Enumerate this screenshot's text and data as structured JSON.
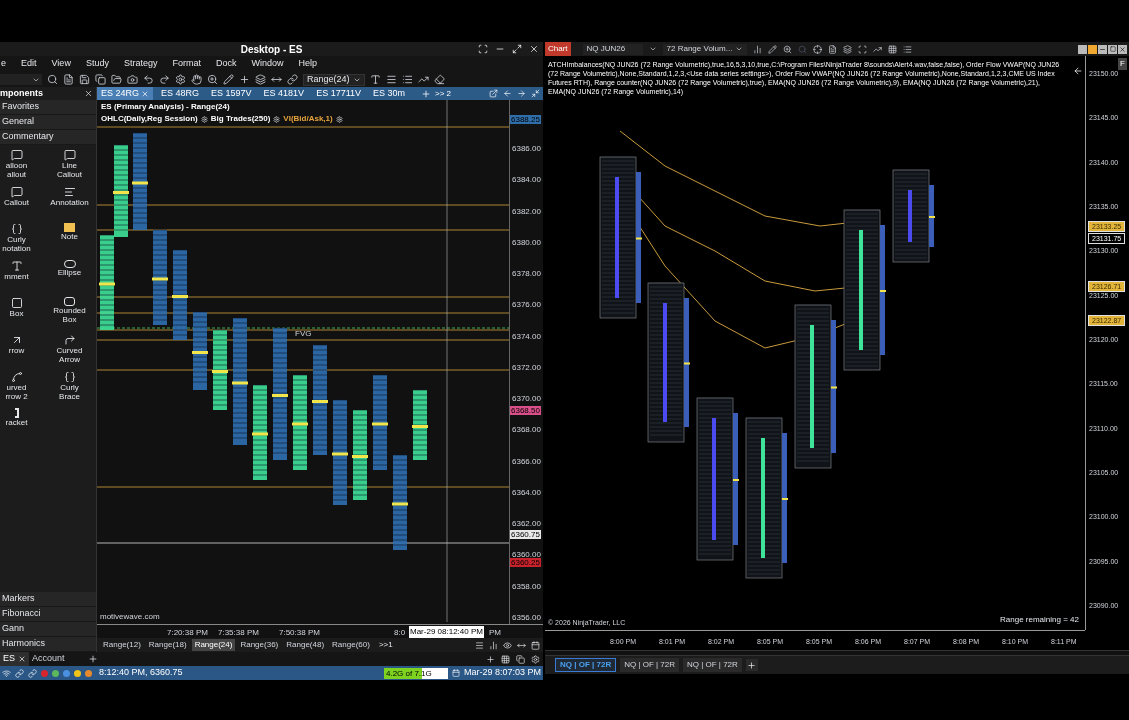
{
  "left_window": {
    "title": "Desktop - ES",
    "menu": [
      "e",
      "Edit",
      "View",
      "Study",
      "Strategy",
      "Format",
      "Dock",
      "Window",
      "Help"
    ],
    "toolbar": {
      "bar_type": "Range(24)"
    },
    "components_panel": {
      "title": "mponents",
      "sections_top": [
        "Favorites",
        "General",
        "Commentary"
      ],
      "tools": [
        {
          "lines": [
            "alloon",
            "allout"
          ]
        },
        {
          "lines": [
            "Line",
            "Callout"
          ]
        },
        {
          "lines": [
            "Callout"
          ]
        },
        {
          "lines": [
            "Annotation"
          ]
        },
        {
          "lines": [
            "Curly",
            "notation"
          ]
        },
        {
          "lines": [
            "Note"
          ]
        },
        {
          "lines": [
            "mment"
          ]
        },
        {
          "lines": [
            "Ellipse"
          ]
        },
        {
          "lines": [
            "Box"
          ]
        },
        {
          "lines": [
            "Rounded",
            "Box"
          ]
        },
        {
          "lines": [
            "rrow"
          ]
        },
        {
          "lines": [
            "Curved",
            "Arrow"
          ]
        },
        {
          "lines": [
            "urved",
            "rrow 2"
          ]
        },
        {
          "lines": [
            "Curly",
            "Brace"
          ]
        },
        {
          "lines": [
            "racket"
          ]
        }
      ],
      "sections_bottom": [
        "Markers",
        "Fibonacci",
        "Gann",
        "Harmonics"
      ]
    },
    "chart_tabs": [
      {
        "label": "ES 24RG",
        "selected": true
      },
      {
        "label": "ES 48RG",
        "selected": false
      },
      {
        "label": "ES 1597V",
        "selected": false
      },
      {
        "label": "ES 4181V",
        "selected": false
      },
      {
        "label": "ES 17711V",
        "selected": false
      },
      {
        "label": "ES 30m",
        "selected": false
      }
    ],
    "chart_tabs_overflow": ">> 2",
    "chart": {
      "title": "ES (Primary Analysis) - Range(24)",
      "studies": [
        {
          "label": "OHLC(Daily,Reg Session)",
          "color": "#ffffff"
        },
        {
          "label": "Big Trades(250)",
          "color": "#ffffff"
        },
        {
          "label": "VI(Bid/Ask,1)",
          "color": "#e8a33c"
        }
      ],
      "fvg_label": "FVG",
      "site_label": "motivewave.com",
      "price_ticks": [
        "6386.00",
        "6384.00",
        "6382.00",
        "6380.00",
        "6378.00",
        "6376.00",
        "6374.00",
        "6372.00",
        "6370.00",
        "6368.00",
        "6366.00",
        "6364.00",
        "6362.00",
        "6360.00",
        "6358.00",
        "6356.00"
      ],
      "price_markers": [
        {
          "label": "6388.25",
          "color": "#2f6ea8"
        },
        {
          "label": "6368.50",
          "color": "#d94f8a"
        },
        {
          "label": "6360.75",
          "color": "#e8e8e8"
        },
        {
          "label": "6360.25",
          "color": "#c8232c"
        }
      ],
      "time_ticks": [
        "7:20:38 PM",
        "7:35:38 PM",
        "7:50:38 PM",
        "8:0"
      ],
      "crosshair_time": "Mar-29 08:12:40 PM",
      "time_tail": "PM"
    },
    "bar_size_tabs": [
      {
        "label": "Range(12)",
        "selected": false
      },
      {
        "label": "Range(18)",
        "selected": false
      },
      {
        "label": "Range(24)",
        "selected": true
      },
      {
        "label": "Range(36)",
        "selected": false
      },
      {
        "label": "Range(48)",
        "selected": false
      },
      {
        "label": "Range(60)",
        "selected": false
      }
    ],
    "bar_size_overflow": ">>1",
    "workspace_tabs": [
      {
        "label": "ES",
        "selected": true
      },
      {
        "label": "Account",
        "selected": false
      }
    ],
    "status": {
      "status_dots": [
        {
          "color": "#d8262e"
        },
        {
          "color": "#5cb85c"
        },
        {
          "color": "#4a90e2"
        },
        {
          "color": "#f0c419"
        },
        {
          "color": "#e8892b"
        }
      ],
      "time_price": "8:12:40 PM, 6360.75",
      "memory": {
        "text": "4.2G of 7.1G",
        "level": 0.59
      },
      "datetime": "Mar-29 8:07:03 PM"
    }
  },
  "right_window": {
    "app_label": "Chart",
    "instrument": "NQ JUN26",
    "series": "72 Range Volum...",
    "indicators_text": "ATCHImbalances(NQ JUN26 (72 Range Volumetric),true,16,5,3,10,true,C:\\Program Files\\NinjaTrader 8\\sounds\\Alert4.wav,false,false), Order Flow VWAP(NQ JUN26 (72 Range Volumetric),None,Standard,1,2,3,<Use data series settings>), Order Flow VWAP(NQ JUN26 (72 Range Volumetric),None,Standard,1,2,3,CME US Index Futures RTH), Range counter(NQ JUN26 (72 Range Volumetric),true), EMA(NQ JUN26 (72 Range Volumetric),9), EMA(NQ JUN26 (72 Range Volumetric),21), EMA(NQ JUN26 (72 Range Volumetric),14)",
    "axis_button": "F",
    "price_ticks": [
      "23150.00",
      "23145.00",
      "23140.00",
      "23135.00",
      "23130.00",
      "23125.00",
      "23120.00",
      "23115.00",
      "23110.00",
      "23105.00",
      "23100.00",
      "23095.00",
      "23090.00"
    ],
    "price_markers": [
      {
        "label": "23133.25",
        "color": "#e2b53a"
      },
      {
        "label": "23131.75",
        "color": "#000000"
      },
      {
        "label": "23126.71",
        "color": "#e2b53a"
      },
      {
        "label": "23122.87",
        "color": "#e2b53a"
      }
    ],
    "copyright": "© 2026 NinjaTrader, LLC",
    "range_remaining": "Range remaining = 42",
    "time_ticks": [
      "8:00 PM",
      "8:01 PM",
      "8:02 PM",
      "8:05 PM",
      "8:05 PM",
      "8:06 PM",
      "8:07 PM",
      "8:08 PM",
      "8:10 PM",
      "8:11 PM"
    ],
    "tabs": [
      {
        "label": "NQ | OF | 72R",
        "selected": true
      },
      {
        "label": "NQ | OF | 72R",
        "selected": false
      },
      {
        "label": "NQ | OF | 72R",
        "selected": false
      }
    ]
  }
}
